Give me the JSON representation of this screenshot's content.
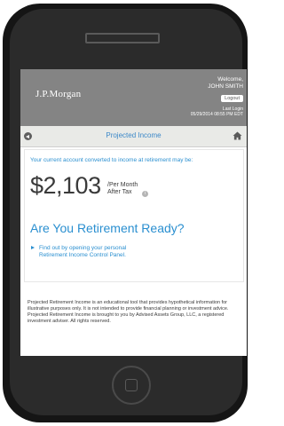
{
  "header": {
    "brand": "J.P.Morgan",
    "welcome_line1": "Welcome,",
    "welcome_line2": "JOHN SMITH",
    "logout_label": "Logout",
    "last_login_label": "Last Login",
    "last_login_value": "05/29/2014 08:55 PM EDT"
  },
  "titlebar": {
    "title": "Projected Income",
    "back_icon": "back-arrow-icon",
    "home_icon": "home-icon"
  },
  "main": {
    "intro": "Your current account converted to income at retirement may be:",
    "amount": "$2,103",
    "per_month": "/Per Month",
    "after_tax": "After Tax",
    "info_icon": "info-icon",
    "ready_heading": "Are You Retirement Ready?",
    "link_line1": "Find out by opening your personal",
    "link_line2": "Retirement Income Control Panel."
  },
  "disclaimer": "Projected Retirement Income is an educational tool that provides hypothetical information for illustrative purposes only. It is not intended to provide financial planning or investment advice. Projected Retirement Income is brought to you by Advised Assets Group, LLC, a registered investment adviser. All rights reserved.",
  "colors": {
    "accent": "#2a8fd0",
    "header_bg": "#848484",
    "phone_body": "#151515"
  }
}
